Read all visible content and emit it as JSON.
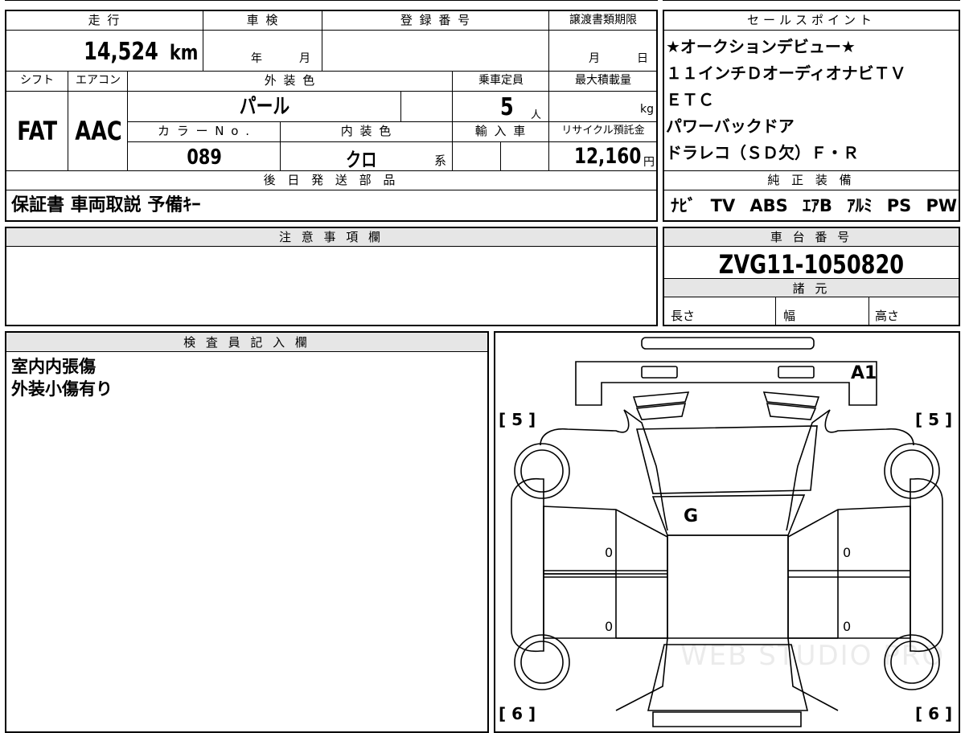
{
  "top": {
    "mileage_label": "走 行",
    "mileage_value": "14,524",
    "mileage_unit": "km",
    "inspection_label": "車 検",
    "inspection_year": "年",
    "inspection_month": "月",
    "registration_label": "登 録 番 号",
    "transfer_label": "譲渡書類期限",
    "transfer_month": "月",
    "transfer_day": "日"
  },
  "spec": {
    "shift_label": "シフト",
    "shift_value": "FAT",
    "aircon_label": "エアコン",
    "aircon_value": "AAC",
    "exterior_color_label": "外 装 色",
    "exterior_color_value": "パール",
    "capacity_label": "乗車定員",
    "capacity_value": "5",
    "capacity_unit": "人",
    "max_load_label": "最大積載量",
    "max_load_unit": "kg",
    "color_no_label": "カ ラ ー N o .",
    "color_no_value": "089",
    "interior_color_label": "内 装 色",
    "interior_color_value": "クロ",
    "interior_color_suffix": "系",
    "import_label": "輸 入 車",
    "recycle_label": "リサイクル預託金",
    "recycle_value": "12,160",
    "recycle_unit": "円"
  },
  "later_parts": {
    "label": "後 日 発 送 部 品",
    "value": "保証書 車両取説 予備ｷｰ"
  },
  "sales_points": {
    "label": "セールスポイント",
    "lines": [
      "★オークションデビュー★",
      "１１インチＤオーディオナビＴＶ",
      "ＥＴＣ",
      "パワーバックドア",
      "ドラレコ（ＳＤ欠）Ｆ・Ｒ"
    ]
  },
  "genuine_equipment": {
    "label": "純 正 装 備",
    "items": [
      "ﾅﾋﾞ",
      "TV",
      "ABS",
      "ｴｱB",
      "ｱﾙﾐ",
      "PS",
      "PW"
    ]
  },
  "notes": {
    "label": "注 意 事 項 欄"
  },
  "chassis": {
    "label": "車 台 番 号",
    "value": "ZVG11-1050820",
    "dimensions_label": "諸 元",
    "length_label": "長さ",
    "width_label": "幅",
    "height_label": "高さ"
  },
  "inspector": {
    "label": "検 査 員 記 入 欄",
    "lines": [
      "室内内張傷",
      "外装小傷有り"
    ]
  },
  "diagram": {
    "front_left_tire": "[ 5 ]",
    "front_right_tire": "[ 5 ]",
    "rear_left_tire": "[ 6 ]",
    "rear_right_tire": "[ 6 ]",
    "mark_a1": "A1",
    "mark_g": "G",
    "door_marks": [
      "0",
      "0",
      "0",
      "0"
    ],
    "watermark": "WEB STUDIO PRO"
  }
}
